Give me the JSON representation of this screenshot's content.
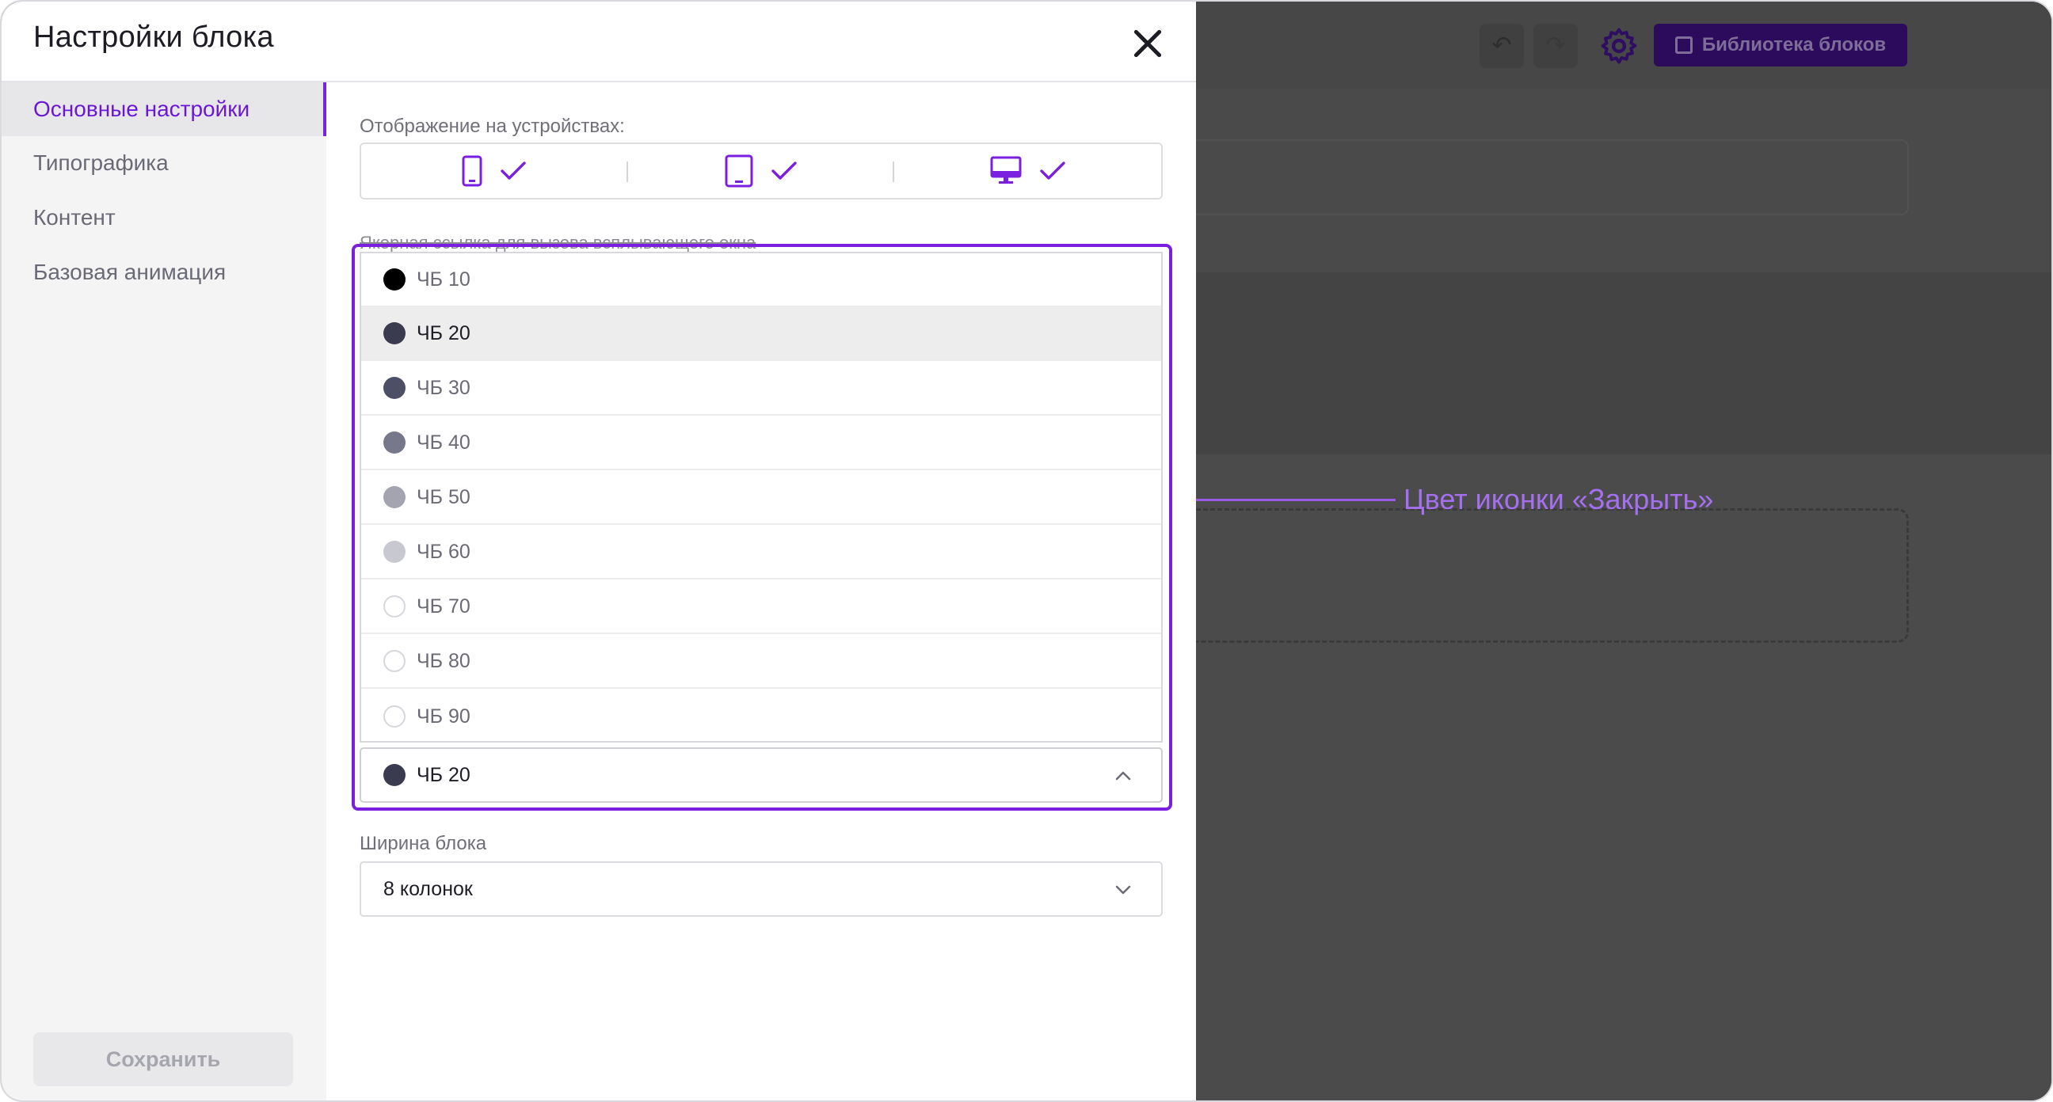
{
  "modal": {
    "title": "Настройки блока",
    "close_icon": "close-icon"
  },
  "sidebar": {
    "items": [
      {
        "label": "Основные настройки",
        "active": true
      },
      {
        "label": "Типографика",
        "active": false
      },
      {
        "label": "Контент",
        "active": false
      },
      {
        "label": "Базовая анимация",
        "active": false
      }
    ],
    "save_label": "Сохранить"
  },
  "devices": {
    "label": "Отображение на устройствах:",
    "items": [
      {
        "icon": "phone-icon",
        "checked": true
      },
      {
        "icon": "tablet-icon",
        "checked": true
      },
      {
        "icon": "desktop-icon",
        "checked": true
      }
    ]
  },
  "anchor_link_label": "Якорная ссылка для вызова всплывающего окна",
  "color_dropdown": {
    "options": [
      {
        "label": "ЧБ 10",
        "color": "#000000"
      },
      {
        "label": "ЧБ 20",
        "color": "#3a3b4e"
      },
      {
        "label": "ЧБ 30",
        "color": "#4d4f66"
      },
      {
        "label": "ЧБ 40",
        "color": "#777889"
      },
      {
        "label": "ЧБ 50",
        "color": "#a4a4b0"
      },
      {
        "label": "ЧБ 60",
        "color": "#c8c8d0"
      },
      {
        "label": "ЧБ 70",
        "color": "#ffffff"
      },
      {
        "label": "ЧБ 80",
        "color": "#ffffff"
      },
      {
        "label": "ЧБ 90",
        "color": "#ffffff"
      }
    ],
    "selected_index": 1,
    "selected": {
      "label": "ЧБ 20",
      "color": "#3a3b4e"
    }
  },
  "annotation": "Цвет иконки «Закрыть»",
  "block_width": {
    "label": "Ширина блока",
    "value": "8 колонок"
  },
  "editor_toolbar": {
    "library_label": "Библиотека блоков"
  },
  "colors": {
    "accent": "#7a1fe0",
    "accent_text": "#6b18d6",
    "annotation": "#a570f0"
  }
}
